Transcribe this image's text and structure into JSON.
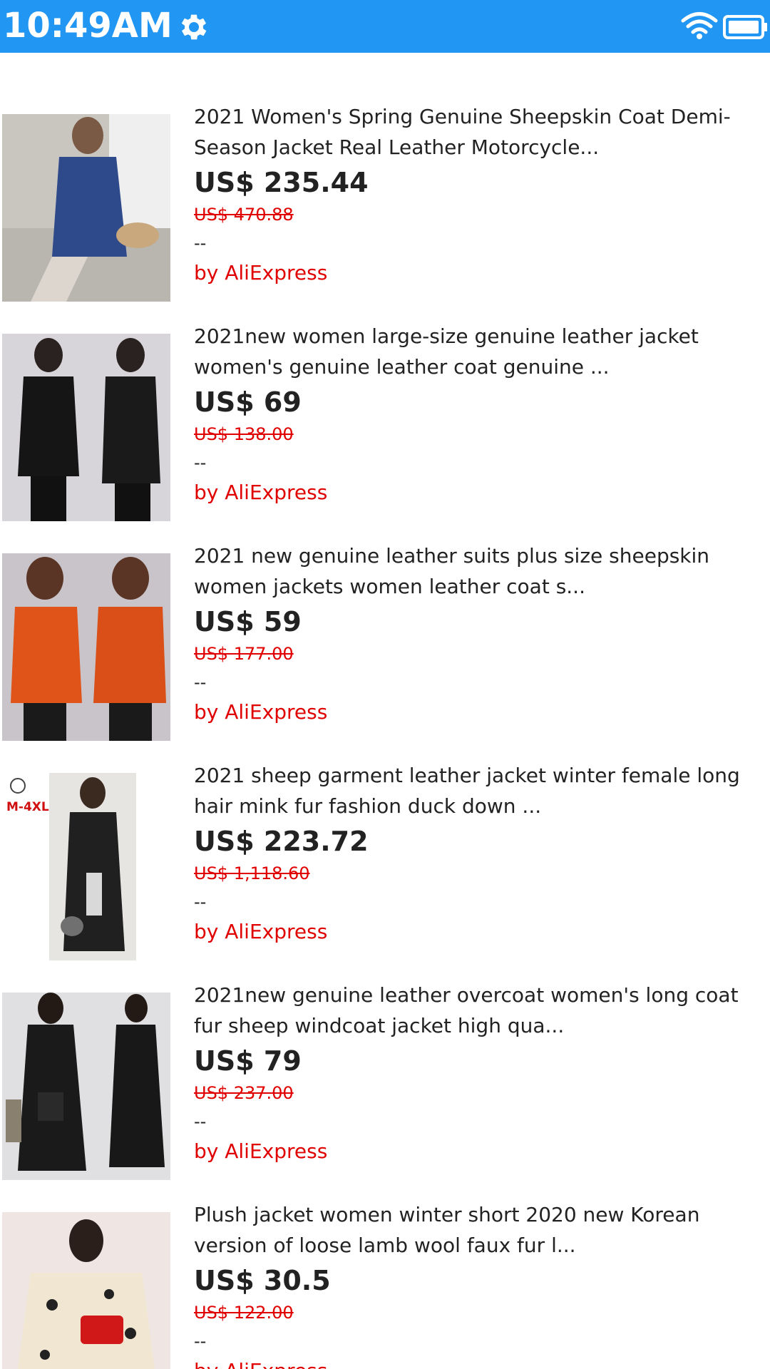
{
  "status": {
    "time": "10:49AM",
    "icons": [
      "gear-icon",
      "wifi-icon",
      "battery-icon"
    ]
  },
  "products": [
    {
      "title": "2021 Women's Spring Genuine Sheepskin Coat Demi-Season Jacket Real Leather Motorcycle...",
      "price": "US$ 235.44",
      "original_price": "US$ 470.88",
      "rating": "--",
      "seller": "by AliExpress",
      "badge": ""
    },
    {
      "title": "2021new women large-size genuine leather jacket women's genuine leather coat genuine ...",
      "price": "US$ 69",
      "original_price": "US$ 138.00",
      "rating": "--",
      "seller": "by AliExpress",
      "badge": ""
    },
    {
      "title": "2021 new genuine leather suits plus size sheepskin women jackets women leather coat s...",
      "price": "US$ 59",
      "original_price": "US$ 177.00",
      "rating": "--",
      "seller": "by AliExpress",
      "badge": ""
    },
    {
      "title": "2021 sheep garment leather jacket winter female long hair mink fur fashion duck down ...",
      "price": "US$ 223.72",
      "original_price": "US$ 1,118.60",
      "rating": "--",
      "seller": "by AliExpress",
      "badge": "M-4XL"
    },
    {
      "title": "2021new genuine leather overcoat women's long coat fur sheep windcoat jacket high qua...",
      "price": "US$ 79",
      "original_price": "US$ 237.00",
      "rating": "--",
      "seller": "by AliExpress",
      "badge": ""
    },
    {
      "title": "Plush jacket women winter short 2020 new Korean version of loose lamb wool faux fur l...",
      "price": "US$ 30.5",
      "original_price": "US$ 122.00",
      "rating": "--",
      "seller": "by AliExpress",
      "badge": ""
    }
  ],
  "colors": {
    "status_bar": "#2196f3",
    "sale_red": "#e00000",
    "text": "#222222"
  }
}
